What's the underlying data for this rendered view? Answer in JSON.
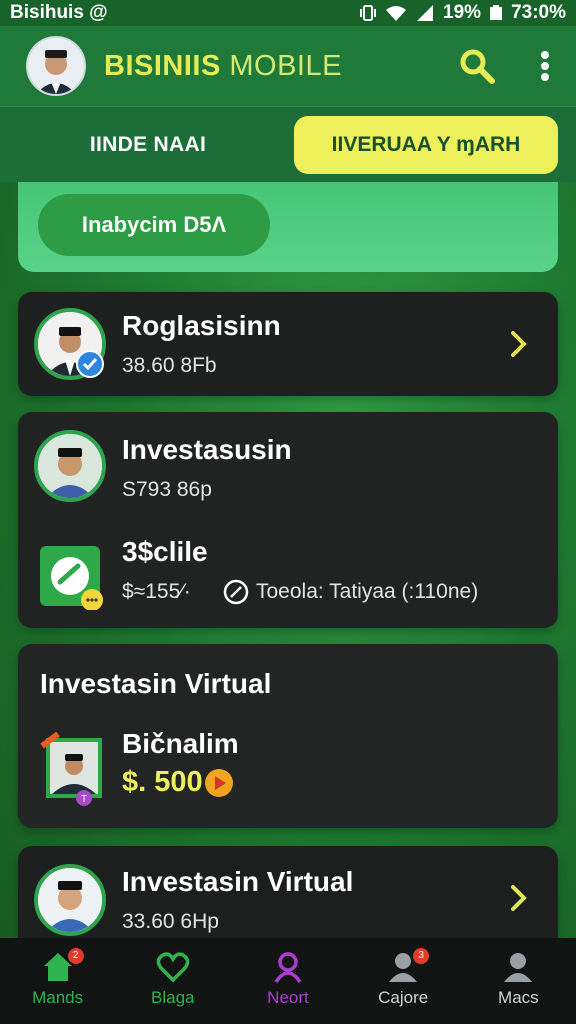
{
  "status_bar": {
    "left_text": "Bisihuis @",
    "battery_text": "19%",
    "time": "73:0%"
  },
  "app_bar": {
    "title_part1": "BISINIIS",
    "title_part2": "MOBILE",
    "icons": [
      "avatar",
      "search-icon",
      "more-vert-icon"
    ]
  },
  "tabs": {
    "left_label": "IINDE NAAI",
    "right_label": "IIVERUAA Y ɱARH"
  },
  "banner": {
    "button_label": "Inabycim D5Λ"
  },
  "cards": [
    {
      "name": "Roglasisinn",
      "amount": "38.60 8Fb"
    },
    {
      "name": "Investasusin",
      "amount": "S793 86p",
      "sub_title": "3$clile",
      "sub_amount": "$≈155⁄·",
      "sub_note": "Toeola: Tatiyaa (:110ne)"
    },
    {
      "heading": "Investasin Virtual",
      "name": "Bičnalim",
      "amount": "$. 500"
    },
    {
      "name": "Investasin Virtual",
      "amount": "33.60 6Hp"
    }
  ],
  "bottom_nav": [
    {
      "label": "Mands",
      "icon": "home-icon",
      "badge": "2"
    },
    {
      "label": "Blaga",
      "icon": "heart-icon"
    },
    {
      "label": "Neort",
      "icon": "profile-active-icon"
    },
    {
      "label": "Cajore",
      "icon": "people-icon",
      "badge": "3"
    },
    {
      "label": "Macs",
      "icon": "person-icon"
    }
  ],
  "colors": {
    "accent_yellow": "#eef05b",
    "primary_green": "#1f7a3a",
    "card_bg": "#1d201e",
    "active_nav": "#b13bd1",
    "nav_green": "#2fb34f"
  }
}
